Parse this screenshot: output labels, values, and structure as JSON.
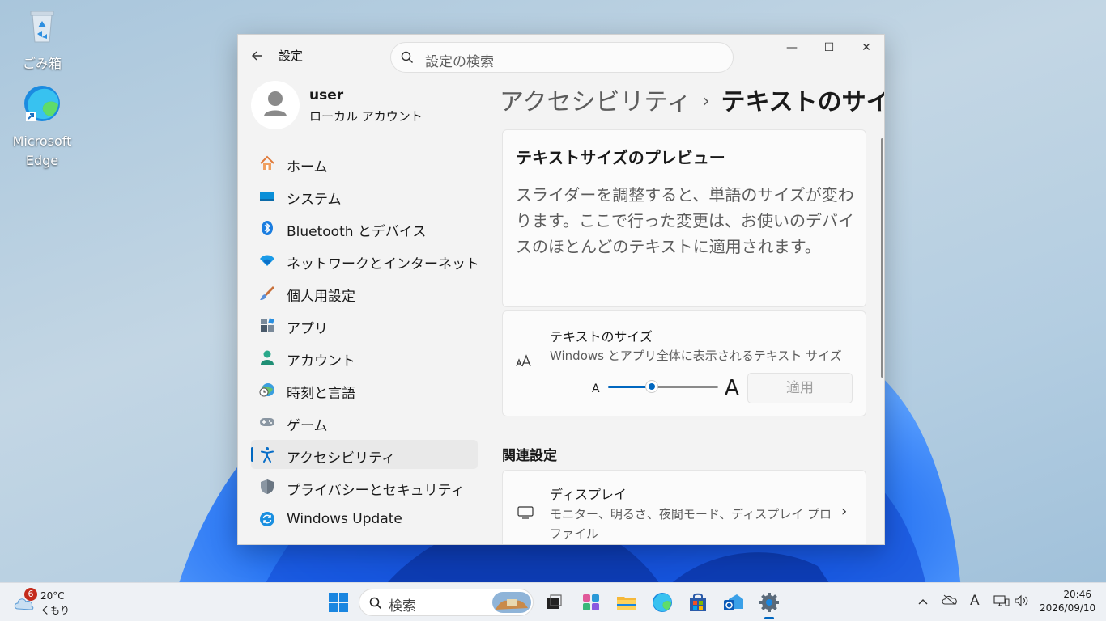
{
  "desktop": {
    "icons": [
      {
        "label": "ごみ箱"
      },
      {
        "label": "Microsoft Edge"
      }
    ]
  },
  "window": {
    "title": "設定",
    "search_placeholder": "設定の検索",
    "controls": {
      "minimize": "—",
      "maximize": "☐",
      "close": "✕"
    }
  },
  "profile": {
    "name": "user",
    "account_type": "ローカル アカウント"
  },
  "sidebar": {
    "items": [
      {
        "label": "ホーム",
        "icon": "home-icon"
      },
      {
        "label": "システム",
        "icon": "system-icon"
      },
      {
        "label": "Bluetooth とデバイス",
        "icon": "bluetooth-icon"
      },
      {
        "label": "ネットワークとインターネット",
        "icon": "wifi-icon"
      },
      {
        "label": "個人用設定",
        "icon": "brush-icon"
      },
      {
        "label": "アプリ",
        "icon": "apps-icon"
      },
      {
        "label": "アカウント",
        "icon": "account-icon"
      },
      {
        "label": "時刻と言語",
        "icon": "globe-clock-icon"
      },
      {
        "label": "ゲーム",
        "icon": "gamepad-icon"
      },
      {
        "label": "アクセシビリティ",
        "icon": "accessibility-icon",
        "active": true
      },
      {
        "label": "プライバシーとセキュリティ",
        "icon": "shield-icon"
      },
      {
        "label": "Windows Update",
        "icon": "update-icon"
      }
    ]
  },
  "breadcrumb": {
    "parent": "アクセシビリティ",
    "separator": "›",
    "current": "テキストのサイズ"
  },
  "preview": {
    "title": "テキストサイズのプレビュー",
    "text": "スライダーを調整すると、単語のサイズが変わります。ここで行った変更は、お使いのデバイスのほとんどのテキストに適用されます。"
  },
  "text_size": {
    "title": "テキストのサイズ",
    "description": "Windows とアプリ全体に表示されるテキスト サイズ",
    "small_label": "A",
    "large_label": "A",
    "slider_level": 0.4,
    "apply_label": "適用"
  },
  "related": {
    "heading": "関連設定",
    "display": {
      "title": "ディスプレイ",
      "description": "モニター、明るさ、夜間モード、ディスプレイ プロファイル"
    }
  },
  "taskbar": {
    "weather": {
      "badge": "6",
      "temperature": "20°C",
      "condition": "くもり"
    },
    "search_placeholder": "検索",
    "clock": {
      "time": "20:46",
      "date": "2026/09/10"
    },
    "ime": "A"
  },
  "colors": {
    "accent": "#0067c0"
  }
}
